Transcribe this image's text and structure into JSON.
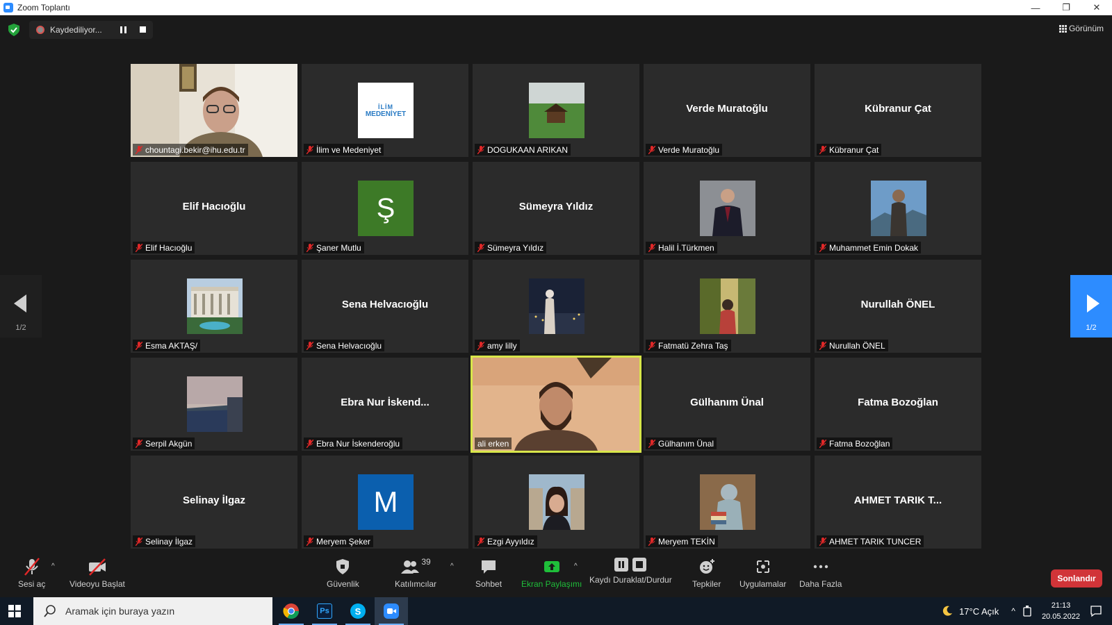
{
  "window": {
    "title": "Zoom Toplantı"
  },
  "recording": {
    "label": "Kaydediliyor..."
  },
  "view": {
    "label": "Görünüm"
  },
  "tiles": [
    {
      "id": "t0",
      "name": "chountagi.bekir@ihu.edu.tr",
      "big": ""
    },
    {
      "id": "t1",
      "name": "İlim ve Medeniyet",
      "big": "",
      "logo_top": "İLİM",
      "logo_bottom": "MEDENİYET"
    },
    {
      "id": "t2",
      "name": "DOGUKAAN ARIKAN",
      "big": ""
    },
    {
      "id": "t3",
      "name": "Verde Muratoğlu",
      "big": "Verde Muratoğlu"
    },
    {
      "id": "t4",
      "name": "Kübranur Çat",
      "big": "Kübranur Çat"
    },
    {
      "id": "t5",
      "name": "Elif Hacıoğlu",
      "big": "Elif Hacıoğlu"
    },
    {
      "id": "t6",
      "name": "Şaner Mutlu",
      "big": "",
      "letter": "Ş"
    },
    {
      "id": "t7",
      "name": "Sümeyra Yıldız",
      "big": "Sümeyra Yıldız"
    },
    {
      "id": "t8",
      "name": "Halil İ.Türkmen",
      "big": ""
    },
    {
      "id": "t9",
      "name": "Muhammet Emin Dokak",
      "big": ""
    },
    {
      "id": "t10",
      "name": "Esma AKTAŞ/",
      "big": ""
    },
    {
      "id": "t11",
      "name": "Sena Helvacıoğlu",
      "big": "Sena Helvacıoğlu"
    },
    {
      "id": "t12",
      "name": "amy lilly",
      "big": ""
    },
    {
      "id": "t13",
      "name": "Fatmatü Zehra Taş",
      "big": ""
    },
    {
      "id": "t14",
      "name": "Nurullah ÖNEL",
      "big": "Nurullah ÖNEL"
    },
    {
      "id": "t15",
      "name": "Serpil Akgün",
      "big": ""
    },
    {
      "id": "t16",
      "name": "Ebra Nur İskenderoğlu",
      "big": "Ebra Nur İskend..."
    },
    {
      "id": "t17",
      "name": "ali erken",
      "big": ""
    },
    {
      "id": "t18",
      "name": "Gülhanım Ünal",
      "big": "Gülhanım Ünal"
    },
    {
      "id": "t19",
      "name": "Fatma Bozoğlan",
      "big": "Fatma Bozoğlan"
    },
    {
      "id": "t20",
      "name": "Selinay İlgaz",
      "big": "Selinay İlgaz"
    },
    {
      "id": "t21",
      "name": "Meryem Şeker",
      "big": "",
      "letter": "M"
    },
    {
      "id": "t22",
      "name": "Ezgi Ayyıldız",
      "big": ""
    },
    {
      "id": "t23",
      "name": "Meryem TEKİN",
      "big": ""
    },
    {
      "id": "t24",
      "name": "AHMET TARIK TUNCER",
      "big": "AHMET TARIK T..."
    }
  ],
  "nav": {
    "left_page": "1/2",
    "right_page": "1/2"
  },
  "toolbar": {
    "unmute": "Sesi aç",
    "start_video": "Videoyu Başlat",
    "security": "Güvenlik",
    "participants": "Katılımcılar",
    "participants_count": "39",
    "chat": "Sohbet",
    "share": "Ekran Paylaşımı",
    "pause_recording": "Kaydı Duraklat/Durdur",
    "reactions": "Tepkiler",
    "apps": "Uygulamalar",
    "more": "Daha Fazla",
    "end": "Sonlandır"
  },
  "colors": {
    "accent": "#2D8CFF",
    "active_speaker": "#d8e64a",
    "end": "#d13438",
    "share_green": "#1fbf3a",
    "mute_red": "#e02828"
  },
  "taskbar": {
    "search_placeholder": "Aramak için buraya yazın",
    "weather": "17°C  Açık",
    "time": "21:13",
    "date": "20.05.2022"
  }
}
